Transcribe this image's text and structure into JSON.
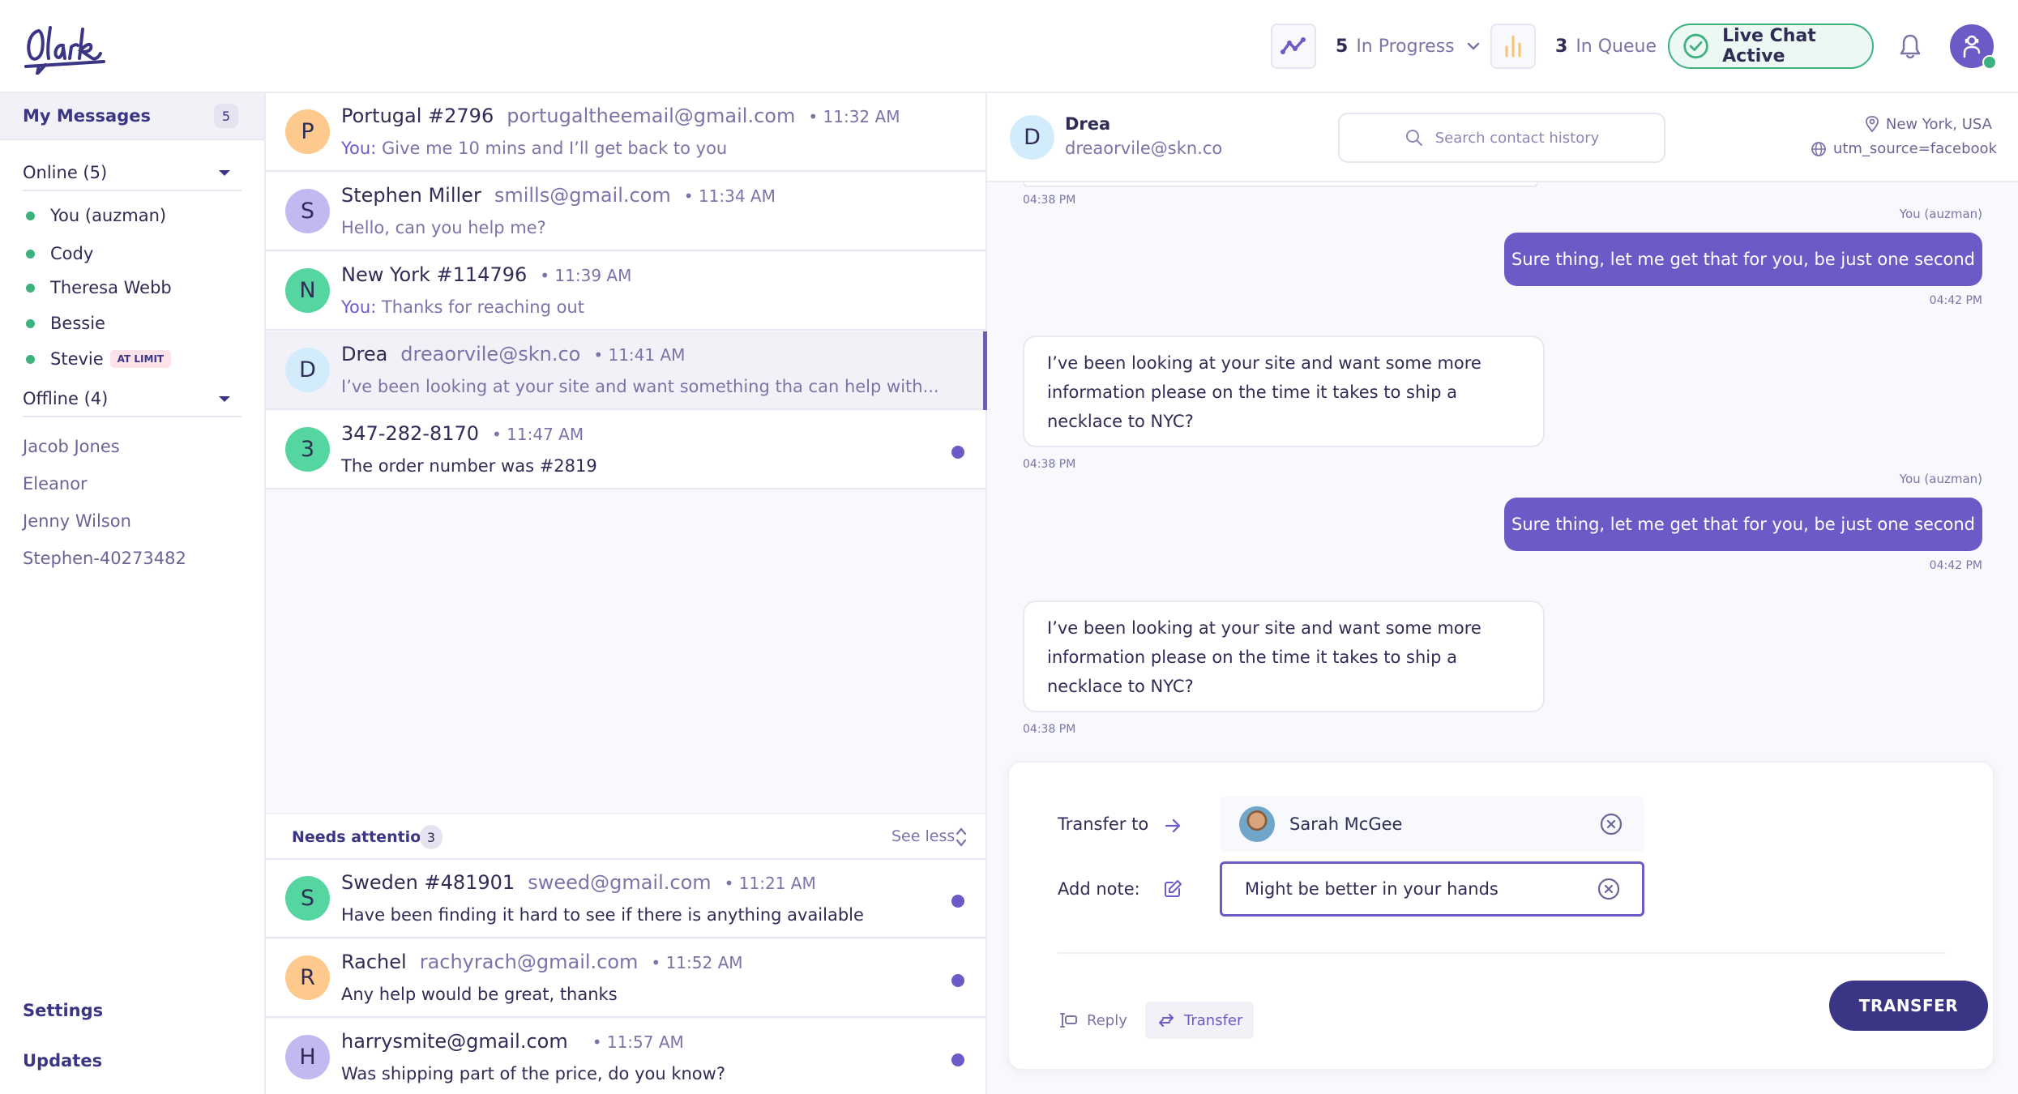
{
  "app": {
    "name": "Olark"
  },
  "header": {
    "in_progress": {
      "count": "5",
      "label": "In Progress",
      "icon": "trend-line-icon"
    },
    "in_queue": {
      "count": "3",
      "label": "In Queue",
      "icon": "bar-chart-icon"
    },
    "live_chat": {
      "label": "Live Chat Active",
      "icon": "check-circle-icon"
    },
    "notifications_icon": "bell-icon",
    "user_avatar_icon": "agent-avatar-icon"
  },
  "sidebar": {
    "my_messages": {
      "label": "My Messages",
      "count": "5"
    },
    "online": {
      "label": "Online (5)",
      "agents": [
        {
          "name": "You (auzman)",
          "badge": ""
        },
        {
          "name": "Cody",
          "badge": ""
        },
        {
          "name": "Theresa Webb",
          "badge": ""
        },
        {
          "name": "Bessie",
          "badge": ""
        },
        {
          "name": "Stevie",
          "badge": "AT LIMIT"
        }
      ]
    },
    "offline": {
      "label": "Offline (4)",
      "agents": [
        "Jacob Jones",
        "Eleanor",
        "Jenny Wilson",
        "Stephen-40273482"
      ]
    },
    "footer": {
      "settings": "Settings",
      "updates": "Updates"
    }
  },
  "conversations": [
    {
      "initial": "P",
      "name": "Portugal #2796",
      "email": "portugaltheemail@gmail.com",
      "time": "• 11:32 AM",
      "prefix": "You:",
      "message": "Give me 10 mins and I’ll get back to you",
      "color": "#fec98c",
      "unread": false,
      "active": false
    },
    {
      "initial": "S",
      "name": "Stephen Miller",
      "email": "smills@gmail.com",
      "time": "• 11:34 AM",
      "prefix": "",
      "message": "Hello, can you help me?",
      "color": "#c3b9f1",
      "unread": false,
      "active": false
    },
    {
      "initial": "N",
      "name": "New York #114796",
      "email": "",
      "time": "• 11:39 AM",
      "prefix": "You:",
      "message": "Thanks for reaching out",
      "color": "#55d5a0",
      "unread": false,
      "active": false
    },
    {
      "initial": "D",
      "name": "Drea",
      "email": "dreaorvile@skn.co",
      "time": "• 11:41 AM",
      "prefix": "",
      "message": "I’ve been looking at your site and want something tha can help with...",
      "color": "#d3ecfc",
      "unread": false,
      "active": true
    },
    {
      "initial": "3",
      "name": "347-282-8170",
      "email": "",
      "time": "• 11:47 AM",
      "prefix": "",
      "message": "The order number was #2819",
      "color": "#55d5a0",
      "unread": true,
      "active": false
    }
  ],
  "needs_attention": {
    "label": "Needs attention",
    "count": "3",
    "toggle": "See less",
    "items": [
      {
        "initial": "S",
        "name": "Sweden #481901",
        "email": "sweed@gmail.com",
        "time": "• 11:21 AM",
        "message": "Have been finding it hard to see if there is anything available",
        "color": "#55d5a0",
        "unread": true
      },
      {
        "initial": "R",
        "name": "Rachel",
        "email": "rachyrach@gmail.com",
        "time": "• 11:52 AM",
        "message": "Any help would be great, thanks",
        "color": "#fec98c",
        "unread": true
      },
      {
        "initial": "H",
        "name": "harrysmite@gmail.com",
        "email": "",
        "time": "• 11:57 AM",
        "message": "Was shipping part of the price, do you know?",
        "color": "#c3b9f1",
        "unread": true
      }
    ]
  },
  "chat": {
    "contact": {
      "initial": "D",
      "name": "Drea",
      "email": "dreaorvile@skn.co"
    },
    "search_placeholder": "Search contact history",
    "location": "New York, USA",
    "source": "utm_source=facebook",
    "messages": [
      {
        "type": "timestamp-in",
        "time": "04:38 PM"
      },
      {
        "type": "out",
        "sender": "You (auzman)",
        "text": "Sure thing, let me get that for you, be just one second",
        "time": "04:42 PM"
      },
      {
        "type": "in",
        "text": "I’ve been looking at your site and want some more information please on the time it takes to ship a necklace to NYC?",
        "time": "04:38 PM"
      },
      {
        "type": "out",
        "sender": "You (auzman)",
        "text": "Sure thing, let me get that for you, be just one second",
        "time": "04:42 PM"
      },
      {
        "type": "in",
        "text": "I’ve been looking at your site and want some more information please on the time it takes to ship a necklace to NYC?",
        "time": "04:38 PM"
      }
    ]
  },
  "transfer": {
    "transfer_to_label": "Transfer to",
    "transfer_to_value": "Sarah McGee",
    "note_label": "Add note:",
    "note_value": "Might be better in your hands",
    "tab_reply": "Reply",
    "tab_transfer": "Transfer",
    "submit": "TRANSFER"
  },
  "colors": {
    "accent": "#6a5bc7",
    "brand_dark": "#3a3585",
    "online": "#3db17e",
    "queue": "#fdbf72"
  }
}
